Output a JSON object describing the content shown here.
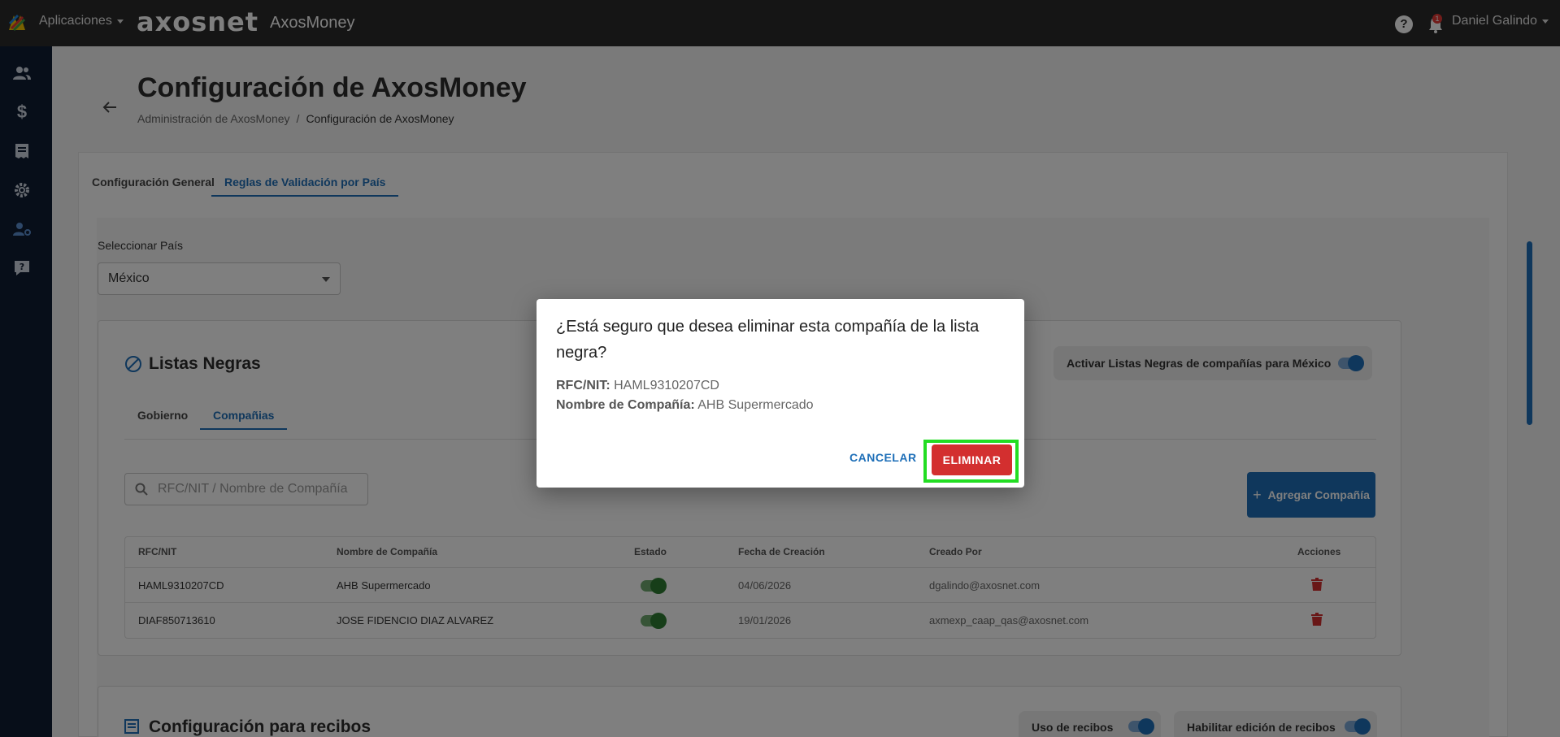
{
  "topbar": {
    "apps_label": "Aplicaciones",
    "brand": "axosnet",
    "app_title": "AxosMoney",
    "help_glyph": "?",
    "notification_count": "1",
    "user_name": "Daniel Galindo"
  },
  "sidebar": {
    "icons": [
      "users-icon",
      "dollar-icon",
      "receipt-icon",
      "gear-icon",
      "user-settings-icon",
      "help-box-icon"
    ]
  },
  "page": {
    "title": "Configuración de AxosMoney",
    "breadcrumb": [
      "Administración de AxosMoney",
      "Configuración de AxosMoney"
    ]
  },
  "tabs": [
    "Configuración General",
    "Reglas de Validación por País"
  ],
  "country": {
    "label": "Seleccionar País",
    "value": "México"
  },
  "blacklist": {
    "title": "Listas Negras",
    "toggle_label": "Activar Listas Negras de compañías para México",
    "sub_tabs": [
      "Gobierno",
      "Compañias"
    ],
    "search_placeholder": "RFC/NIT / Nombre de Compañía",
    "add_button": "Agregar Compañía",
    "columns": [
      "RFC/NIT",
      "Nombre de Compañía",
      "Estado",
      "Fecha de Creación",
      "Creado Por",
      "Acciones"
    ],
    "rows": [
      {
        "rfc": "HAML9310207CD",
        "name": "AHB Supermercado",
        "date": "04/06/2026",
        "created_by": "dgalindo@axosnet.com"
      },
      {
        "rfc": "DIAF850713610",
        "name": "JOSE FIDENCIO DIAZ ALVAREZ",
        "date": "19/01/2026",
        "created_by": "axmexp_caap_qas@axosnet.com"
      }
    ]
  },
  "receipts": {
    "title": "Configuración para recibos",
    "toggle1": "Uso de recibos",
    "toggle2": "Habilitar edición de recibos"
  },
  "modal": {
    "title": "¿Está seguro que desea eliminar esta compañía de la lista negra?",
    "rfc_label": "RFC/NIT:",
    "rfc_value": "HAML9310207CD",
    "name_label": "Nombre de Compañía:",
    "name_value": "AHB Supermercado",
    "cancel": "CANCELAR",
    "delete": "ELIMINAR"
  },
  "colors": {
    "primary": "#1e6fb8",
    "danger": "#d32f2f",
    "sidebar": "#0e1c32",
    "topbar": "#2b2b2b",
    "highlight": "#22dd22"
  }
}
